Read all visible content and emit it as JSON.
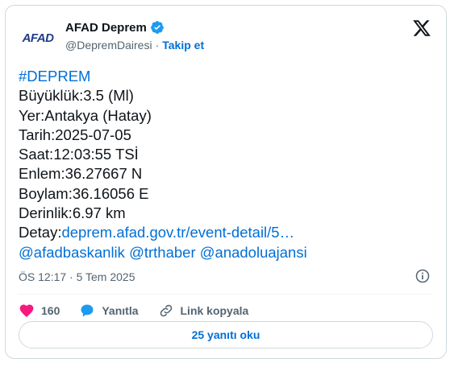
{
  "account": {
    "avatar_text": "AFAD",
    "name": "AFAD Deprem",
    "handle": "@DepremDairesi",
    "separator": "·",
    "follow_label": "Takip et"
  },
  "tweet": {
    "hashtag": "#DEPREM",
    "magnitude": "Büyüklük:3.5 (Ml)",
    "location": "Yer:Antakya (Hatay)",
    "date": "Tarih:2025-07-05",
    "time": "Saat:12:03:55 TSİ",
    "lat": "Enlem:36.27667 N",
    "lon": "Boylam:36.16056 E",
    "depth": "Derinlik:6.97 km",
    "detail_label": "Detay:",
    "detail_link": "deprem.afad.gov.tr/event-detail/5…",
    "mentions": [
      "@afadbaskanlik",
      "@trthaber",
      "@anadoluajansi"
    ]
  },
  "meta": {
    "timestamp": "ÖS 12:17 · 5 Tem 2025"
  },
  "actions": {
    "like_count": "160",
    "reply_label": "Yanıtla",
    "copy_link_label": "Link kopyala"
  },
  "replies_button": "25 yanıtı oku",
  "colors": {
    "link": "#006fd6",
    "heart": "#f91880",
    "verified": "#1d9bf0"
  }
}
